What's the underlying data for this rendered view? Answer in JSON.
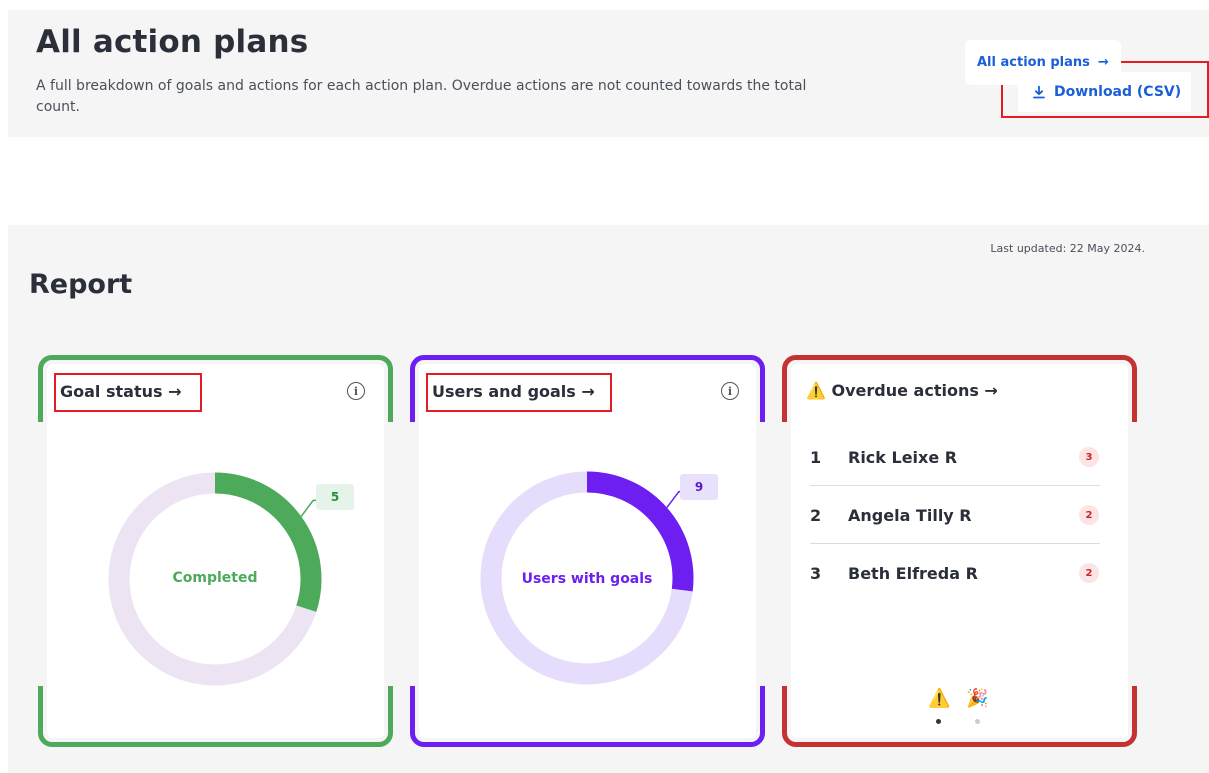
{
  "header": {
    "title": "All action plans",
    "description": "A full breakdown of goals and actions for each action plan. Overdue actions are not counted towards the total count.",
    "download_label": "Download (CSV)",
    "download_icon": "download-icon"
  },
  "report": {
    "title": "Report",
    "last_updated": "Last updated: 22 May 2024.",
    "all_plans_label": "All action plans",
    "arrow": "→"
  },
  "goal_status": {
    "title": "Goal status →",
    "center_label": "Completed",
    "value": "5",
    "fraction": 0.3,
    "color": "#4caa5a",
    "track_color": "#ece4f3",
    "frame_color": "#4caa5a",
    "badge_bg": "#e6f3e8",
    "badge_fg": "#2e8b3e",
    "info_icon": "i"
  },
  "users_goals": {
    "title": "Users and goals →",
    "center_label": "Users with goals",
    "value": "9",
    "fraction": 0.27,
    "color": "#6d1ef0",
    "track_color": "#e6dcfb",
    "frame_color": "#6d1ef0",
    "badge_bg": "#e9e1fc",
    "badge_fg": "#5a18cc",
    "info_icon": "i"
  },
  "overdue": {
    "title": "Overdue actions →",
    "warning_icon": "⚠️",
    "frame_color": "#c53232",
    "rows": [
      {
        "rank": "1",
        "name": "Rick Leixe R",
        "count": "3"
      },
      {
        "rank": "2",
        "name": "Angela Tilly R",
        "count": "2"
      },
      {
        "rank": "3",
        "name": "Beth Elfreda R",
        "count": "2"
      }
    ],
    "carousel": [
      {
        "icon": "⚠️",
        "active": true
      },
      {
        "icon": "🎉",
        "active": false
      }
    ]
  }
}
